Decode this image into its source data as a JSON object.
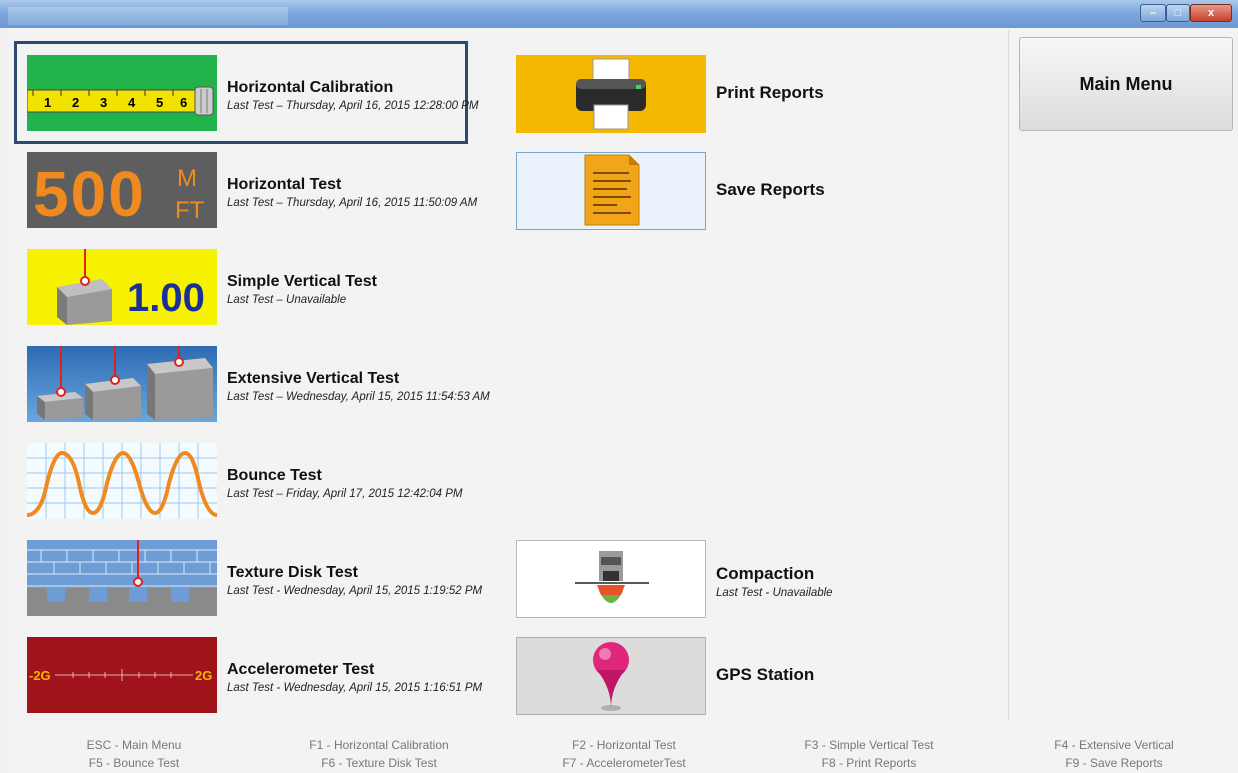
{
  "window": {
    "controls": {
      "minimize": "–",
      "maximize": "□",
      "close": "x"
    }
  },
  "tests": [
    {
      "title": "Horizontal Calibration",
      "last_test": "Last Test – Thursday, April 16, 2015 12:28:00 PM",
      "icon": "tape-measure-icon",
      "tape_ticks": [
        "1",
        "2",
        "3",
        "4",
        "5",
        "6"
      ]
    },
    {
      "title": "Horizontal Test",
      "last_test": "Last Test – Thursday, April 16, 2015 11:50:09 AM",
      "icon": "digital-display-icon",
      "display_value": "500",
      "units": [
        "M",
        "FT"
      ]
    },
    {
      "title": "Simple Vertical Test",
      "last_test": "Last Test – Unavailable",
      "icon": "block-drop-icon",
      "value": "1.00"
    },
    {
      "title": "Extensive Vertical Test",
      "last_test": "Last Test – Wednesday, April 15, 2015 11:54:53 AM",
      "icon": "three-blocks-icon"
    },
    {
      "title": "Bounce Test",
      "last_test": "Last Test – Friday, April 17, 2015 12:42:04 PM",
      "icon": "bounce-wave-icon"
    },
    {
      "title": "Texture Disk Test",
      "last_test": "Last Test - Wednesday, April 15, 2015 1:19:52 PM",
      "icon": "texture-disk-icon"
    },
    {
      "title": "Accelerometer Test",
      "last_test": "Last Test - Wednesday, April 15, 2015 1:16:51 PM",
      "icon": "accelerometer-scale-icon",
      "scale_left": "-2G",
      "scale_right": "2G"
    }
  ],
  "reports": [
    {
      "title": "Print Reports",
      "icon": "printer-icon"
    },
    {
      "title": "Save Reports",
      "icon": "document-icon"
    }
  ],
  "extras": [
    {
      "title": "Compaction",
      "last_test": "Last Test - Unavailable",
      "icon": "compaction-icon"
    },
    {
      "title": "GPS Station",
      "icon": "map-pin-icon"
    }
  ],
  "main_menu": {
    "label": "Main Menu"
  },
  "shortcuts": [
    [
      "ESC - Main Menu",
      "F5 - Bounce Test"
    ],
    [
      "F1 - Horizontal Calibration",
      "F6 - Texture Disk Test"
    ],
    [
      "F2 - Horizontal Test",
      "F7 - AccelerometerTest"
    ],
    [
      "F3 - Simple Vertical Test",
      "F8 - Print Reports"
    ],
    [
      "F4 - Extensive Vertical",
      "F9 - Save Reports"
    ]
  ],
  "colors": {
    "selection_border": "#2b4a6f",
    "calibration_green": "#22b24c",
    "display_bg": "#5e5e5e",
    "display_digits": "#f08a1e",
    "yellow": "#f6f200",
    "print_bg": "#f5b800",
    "accel_bg": "#a0131b"
  }
}
